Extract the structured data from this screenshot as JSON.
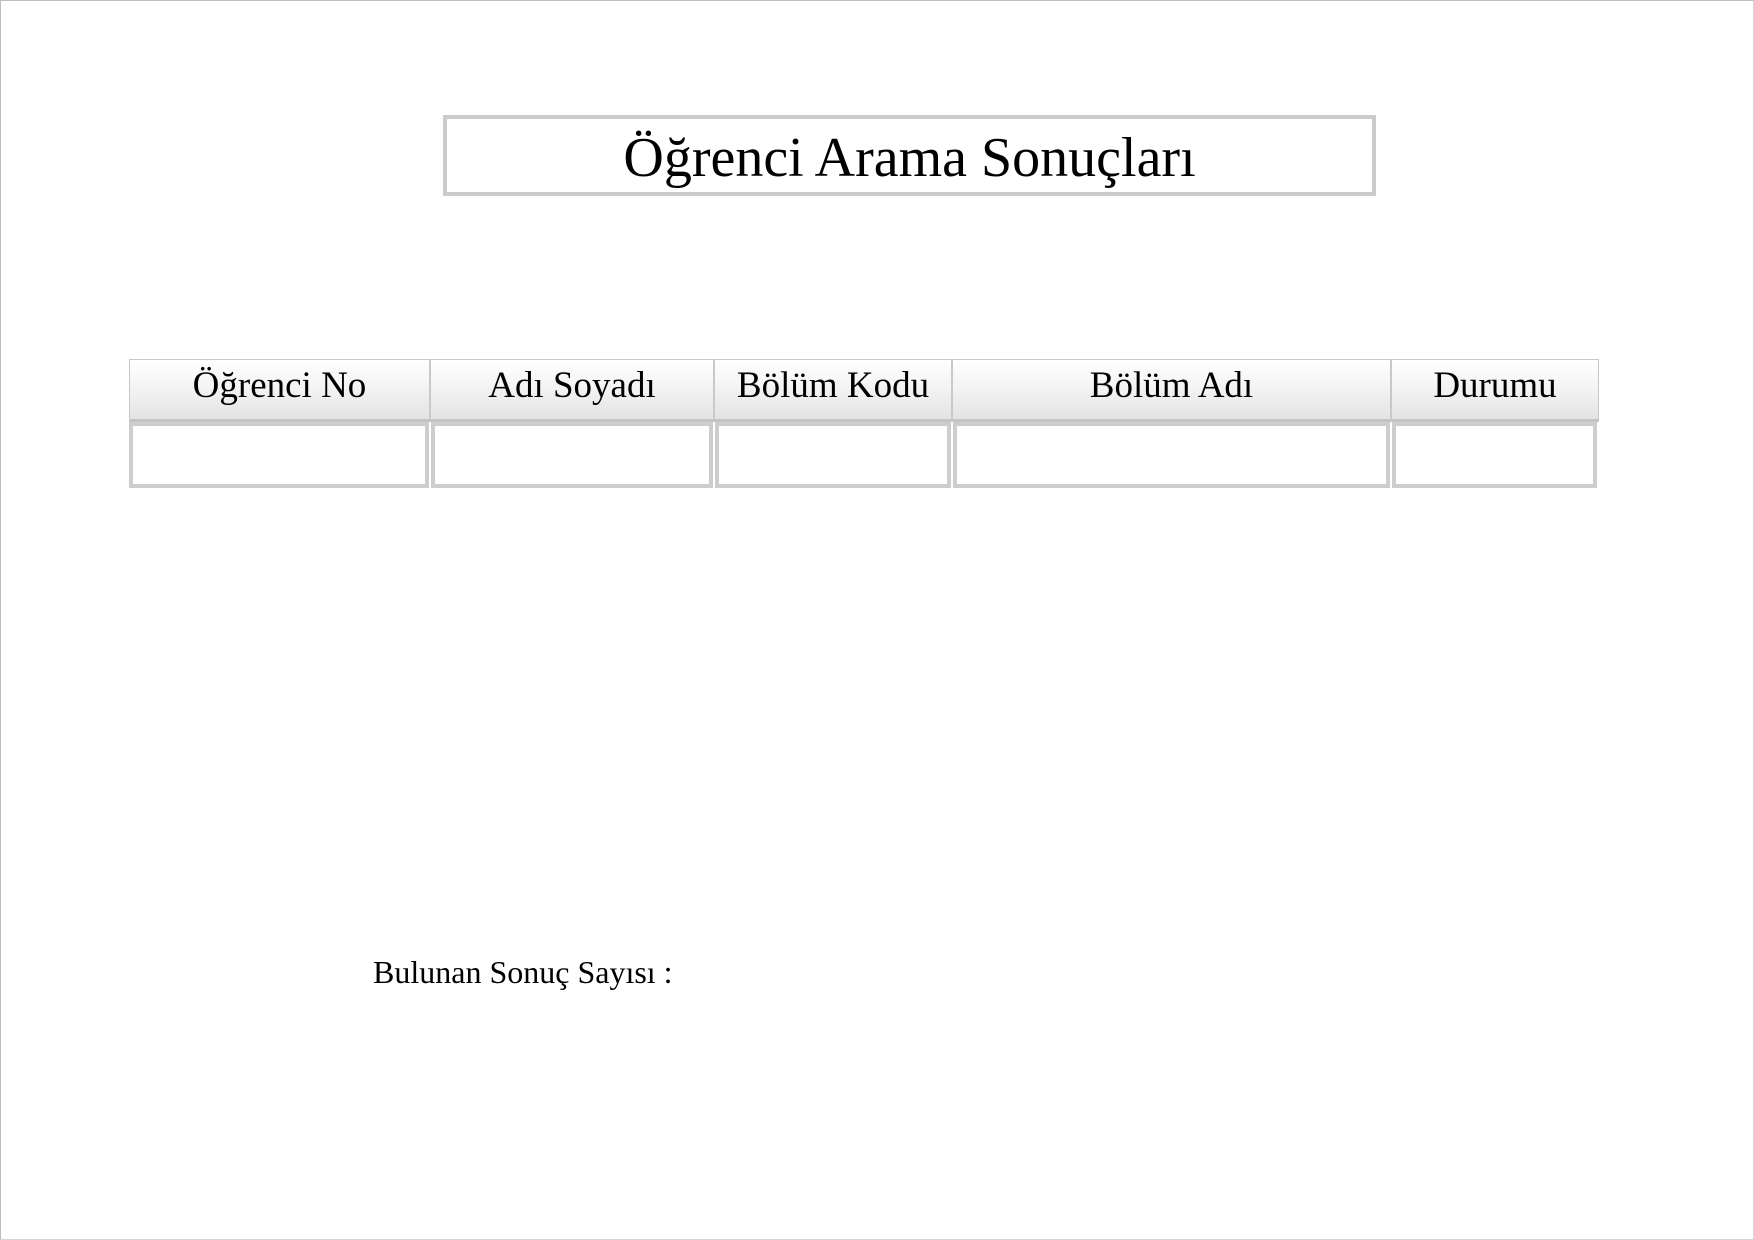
{
  "title": "Öğrenci Arama Sonuçları",
  "table": {
    "headers": [
      "Öğrenci No",
      "Adı Soyadı",
      "Bölüm Kodu",
      "Bölüm Adı",
      "Durumu"
    ],
    "rows": [
      [
        "",
        "",
        "",
        "",
        ""
      ]
    ]
  },
  "result_count_label": "Bulunan Sonuç Sayısı :"
}
